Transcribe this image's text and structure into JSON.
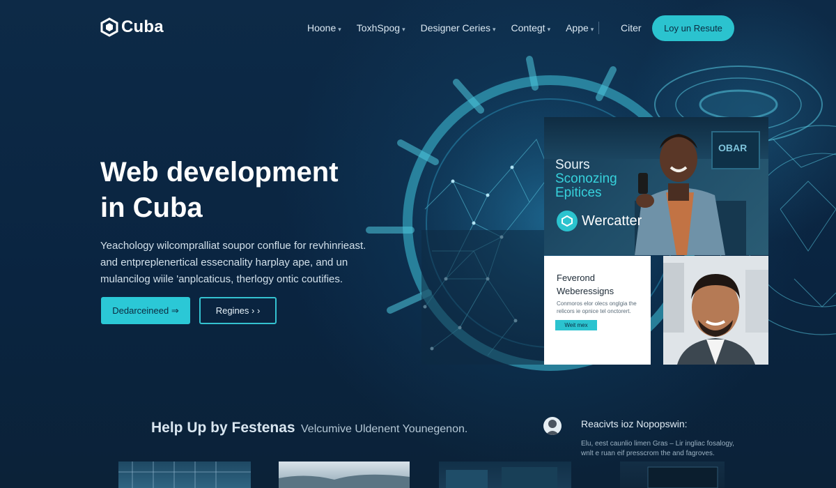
{
  "brand": {
    "name": "Cuba",
    "icon": "hexagon-logo-icon"
  },
  "nav": {
    "items": [
      {
        "label": "Hoone",
        "caret": "▾"
      },
      {
        "label": "ToxhSpog",
        "caret": "▾"
      },
      {
        "label": "Designer Ceries",
        "caret": "▾"
      },
      {
        "label": "Contegt",
        "caret": "▾"
      },
      {
        "label": "Appe",
        "caret": "▾"
      }
    ],
    "extra": "Citer",
    "cta": "Loy un Resute"
  },
  "hero": {
    "title_line1": "Web development",
    "title_line2": "in Cuba",
    "desc_line1": "Yeachology wilcompralliat soupor conflue for revhinrieast.",
    "desc_line2": "and entpreplenertical essecnality harplay ape, and un",
    "desc_line3": "mulancilog wiile 'anplcaticus, therlogy ontic coutifies.",
    "primary_button": "Dedarceineed ⇒",
    "secondary_button": "Regines › ›"
  },
  "collage": {
    "title_line1": "Sours",
    "title_line2": "Sconozing",
    "title_line3": "Epitices",
    "brand_text": "Wercatter",
    "screen_text": "OBAR",
    "card_title_line1": "Feverond",
    "card_title_line2": "Weberessigns",
    "card_body_line1": "Conmoros elor olecs onglgia the",
    "card_body_line2": "relicors ie opnice tel onctorert.",
    "card_button": "Weit mex"
  },
  "bottom": {
    "heading_strong": "Help Up by Festenas",
    "heading_light": "Velcumive Uldenent Younegenon.",
    "review_title": "Reacivts ioz Nopopswin:",
    "review_line1": "Elu, eest caunlio limen Gras – Lir ingliac fosalogy,",
    "review_line2": "wnlt e ruan eif presscrom the and fagroves."
  },
  "colors": {
    "accent": "#2bc3cf",
    "background": "#0b2540",
    "text": "#ffffff"
  }
}
